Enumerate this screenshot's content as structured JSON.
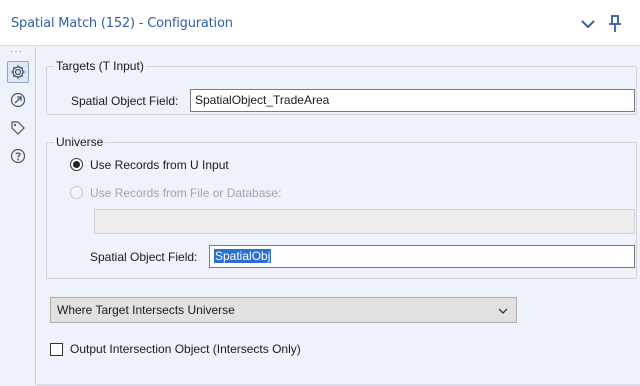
{
  "window": {
    "title": "Spatial Match (152) - Configuration"
  },
  "sidebar": {
    "items": [
      {
        "icon": "gear-icon",
        "active": true
      },
      {
        "icon": "arrow-circle-icon",
        "active": false
      },
      {
        "icon": "tag-icon",
        "active": false
      },
      {
        "icon": "help-icon",
        "active": false
      }
    ]
  },
  "targets": {
    "legend": "Targets (T Input)",
    "field_label": "Spatial Object Field:",
    "field_value": "SpatialObject_TradeArea"
  },
  "universe": {
    "legend": "Universe",
    "option_u_input": "Use Records from U Input",
    "option_file_db": "Use Records from File or Database:",
    "selected_option": "Use Records from U Input",
    "file_path_value": "",
    "field_label": "Spatial Object Field:",
    "field_value": "SpatialObj"
  },
  "action": {
    "selected": "Where Target Intersects Universe"
  },
  "output_intersection": {
    "label": "Output Intersection Object (Intersects Only)",
    "checked": false
  },
  "colors": {
    "accent": "#2e5fa8",
    "selection": "#2c6fd1",
    "panel_bg": "#eef2fb"
  }
}
